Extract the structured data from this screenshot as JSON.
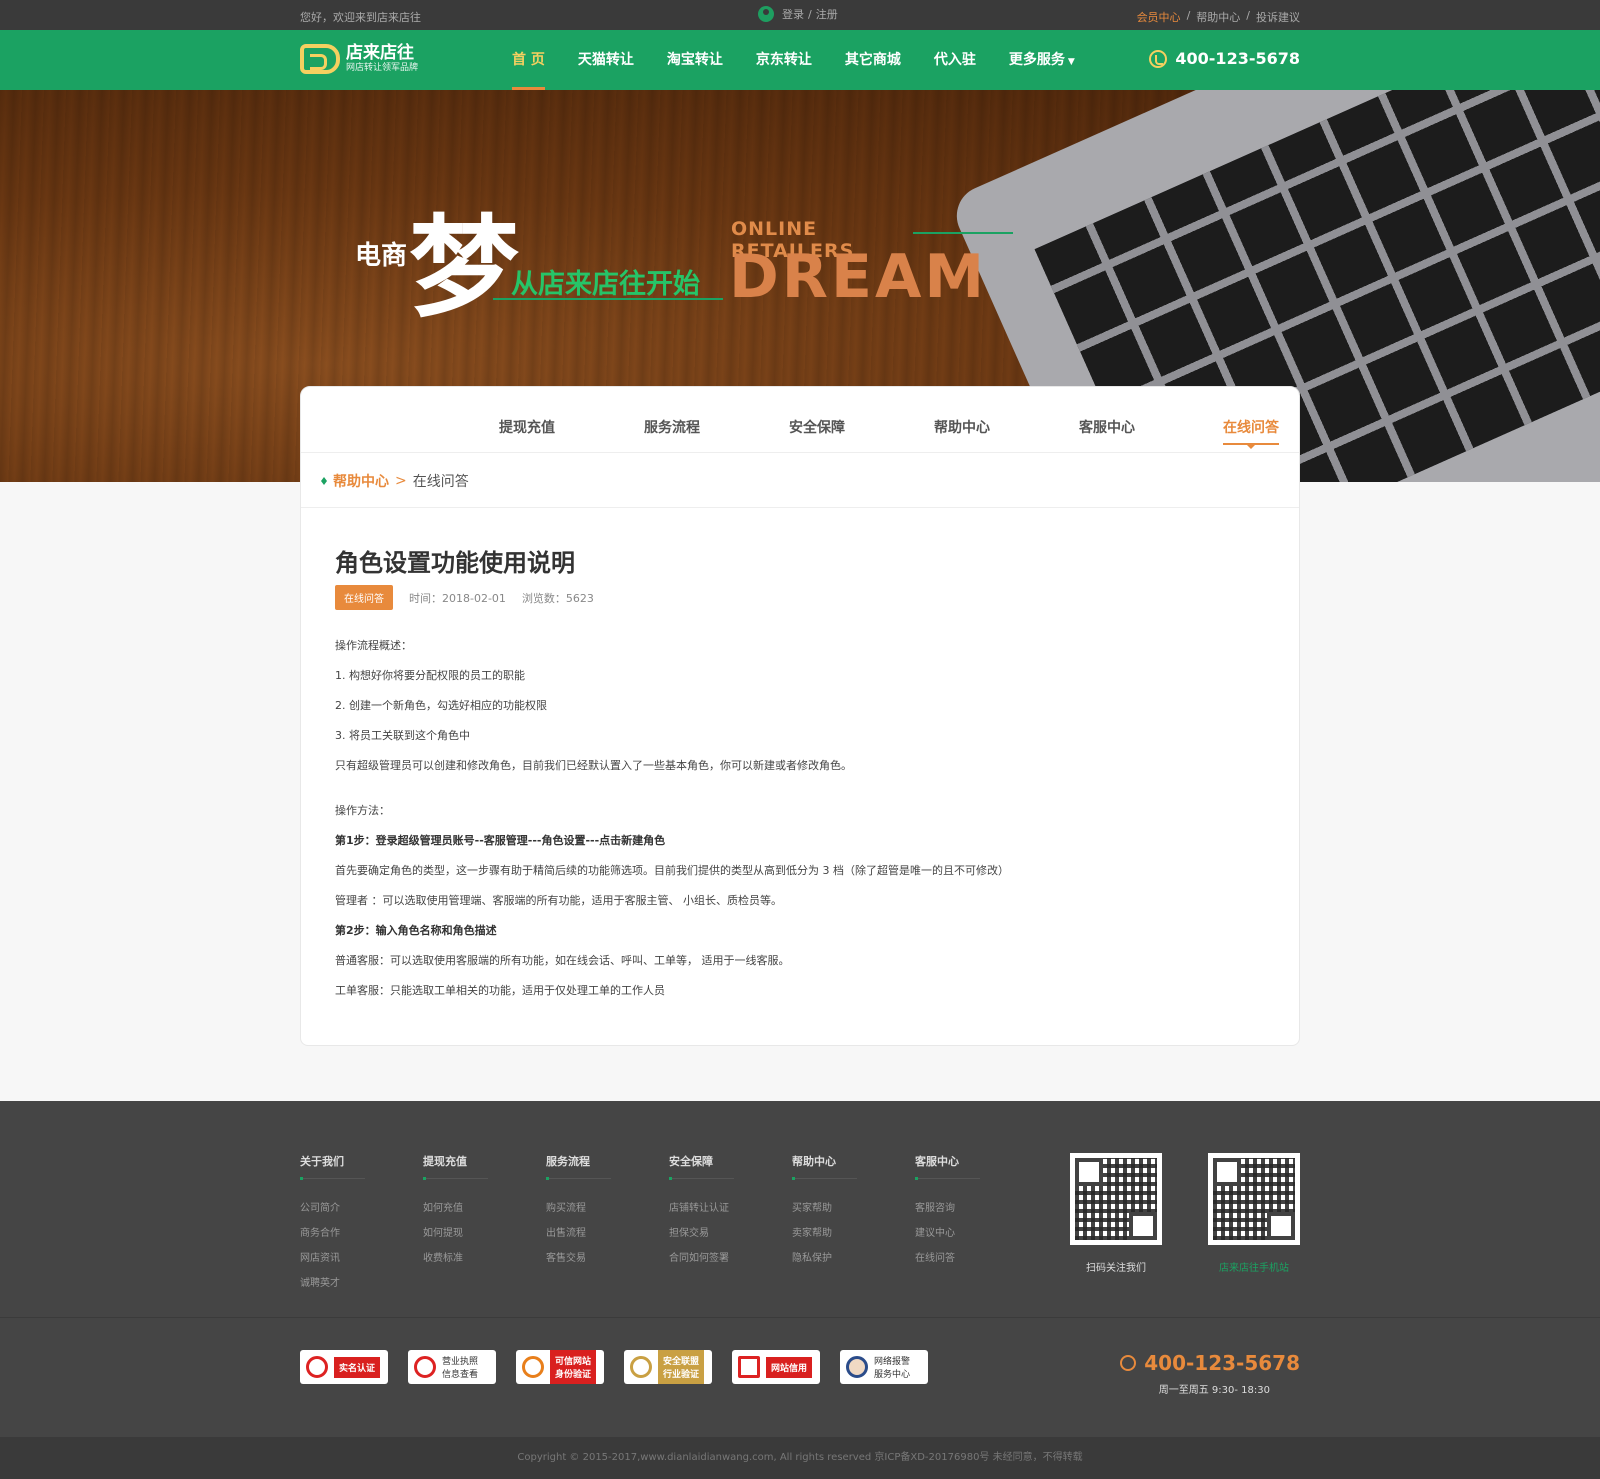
{
  "topbar": {
    "welcome": "您好，欢迎来到店来店往",
    "login": "登录",
    "sep": "/",
    "register": "注册",
    "links": [
      "会员中心",
      "帮助中心",
      "投诉建议"
    ]
  },
  "header": {
    "logo_name": "店来店往",
    "logo_slogan": "网店转让领军品牌",
    "nav": [
      "首 页",
      "天猫转让",
      "淘宝转让",
      "京东转让",
      "其它商城",
      "代入驻",
      "更多服务"
    ],
    "phone": "400-123-5678"
  },
  "banner": {
    "ds": "电商",
    "meng": "梦",
    "cn": "从店来店往开始",
    "en_small": "ONLINE RETAILERS",
    "en_big": "DREAM"
  },
  "subnav": [
    "提现充值",
    "服务流程",
    "安全保障",
    "帮助中心",
    "客服中心",
    "在线问答"
  ],
  "breadcrumb": {
    "parent": "帮助中心",
    "sep": ">",
    "current": "在线问答"
  },
  "article": {
    "title": "角色设置功能使用说明",
    "tag": "在线问答",
    "time": "时间：2018-02-01",
    "views": "浏览数：5623",
    "paragraphs": [
      "操作流程概述：",
      "1. 构想好你将要分配权限的员工的职能",
      "2. 创建一个新角色，勾选好相应的功能权限",
      "3. 将员工关联到这个角色中",
      "只有超级管理员可以创建和修改角色，目前我们已经默认置入了一些基本角色，你可以新建或者修改角色。",
      "操作方法：",
      "第1步：登录超级管理员账号--客服管理---角色设置---点击新建角色",
      "首先要确定角色的类型，这一步骤有助于精简后续的功能筛选项。目前我们提供的类型从高到低分为 3 档（除了超管是唯一的且不可修改）",
      "管理者 ：可以选取使用管理端、客服端的所有功能，适用于客服主管、 小组长、质检员等。",
      "第2步：输入角色名称和角色描述",
      "普通客服：可以选取使用客服端的所有功能，如在线会话、呼叫、工单等， 适用于一线客服。",
      "工单客服：只能选取工单相关的功能，适用于仅处理工单的工作人员"
    ]
  },
  "footer": {
    "columns": [
      {
        "title": "关于我们",
        "items": [
          "公司简介",
          "商务合作",
          "网店资讯",
          "诚聘英才"
        ]
      },
      {
        "title": "提现充值",
        "items": [
          "如何充值",
          "如何提现",
          "收费标准"
        ]
      },
      {
        "title": "服务流程",
        "items": [
          "购买流程",
          "出售流程",
          "客售交易"
        ]
      },
      {
        "title": "安全保障",
        "items": [
          "店铺转让认证",
          "担保交易",
          "合同如何签署"
        ]
      },
      {
        "title": "帮助中心",
        "items": [
          "买家帮助",
          "卖家帮助",
          "隐私保护"
        ]
      },
      {
        "title": "客服中心",
        "items": [
          "客服咨询",
          "建议中心",
          "在线问答"
        ]
      }
    ],
    "qr1_caption": "扫码关注我们",
    "qr2_caption": "店来店往手机站",
    "badges": [
      "实名认证",
      "营业执照\n信息查看",
      "可信网站\n身份验证",
      "安全联盟\n行业验证",
      "网站信用",
      "网络报警\n服务中心"
    ],
    "phone": "400-123-5678",
    "hours": "周一至周五 9:30- 18:30",
    "copyright": "Copyright © 2015-2017,www.dianlaidianwang.com, All rights reserved 京ICP备XD-20176980号 未经同意，不得转载"
  },
  "colors": {
    "green": "#1ba262",
    "orange": "#e88a3c",
    "dark": "#3a3a3a"
  }
}
